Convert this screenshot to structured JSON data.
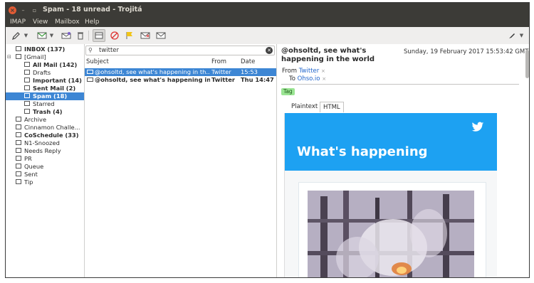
{
  "window": {
    "title": "Spam - 18 unread - Trojitá"
  },
  "menu": [
    "IMAP",
    "View",
    "Mailbox",
    "Help"
  ],
  "folders": [
    {
      "label": "INBOX (137)",
      "bold": true,
      "indent": 0,
      "expander": ""
    },
    {
      "label": "[Gmail]",
      "bold": false,
      "indent": 0,
      "expander": "⊟"
    },
    {
      "label": "All Mail (142)",
      "bold": true,
      "indent": 1,
      "expander": ""
    },
    {
      "label": "Drafts",
      "bold": false,
      "indent": 1,
      "expander": ""
    },
    {
      "label": "Important (14)",
      "bold": true,
      "indent": 1,
      "expander": ""
    },
    {
      "label": "Sent Mail (2)",
      "bold": true,
      "indent": 1,
      "expander": ""
    },
    {
      "label": "Spam (18)",
      "bold": true,
      "indent": 1,
      "expander": "",
      "selected": true
    },
    {
      "label": "Starred",
      "bold": false,
      "indent": 1,
      "expander": ""
    },
    {
      "label": "Trash (4)",
      "bold": true,
      "indent": 1,
      "expander": ""
    },
    {
      "label": "Archive",
      "bold": false,
      "indent": 0,
      "expander": ""
    },
    {
      "label": "Cinnamon Challe...",
      "bold": false,
      "indent": 0,
      "expander": ""
    },
    {
      "label": "CoSchedule (33)",
      "bold": true,
      "indent": 0,
      "expander": ""
    },
    {
      "label": "N1-Snoozed",
      "bold": false,
      "indent": 0,
      "expander": ""
    },
    {
      "label": "Needs Reply",
      "bold": false,
      "indent": 0,
      "expander": ""
    },
    {
      "label": "PR",
      "bold": false,
      "indent": 0,
      "expander": ""
    },
    {
      "label": "Queue",
      "bold": false,
      "indent": 0,
      "expander": ""
    },
    {
      "label": "Sent",
      "bold": false,
      "indent": 0,
      "expander": ""
    },
    {
      "label": "Tip",
      "bold": false,
      "indent": 0,
      "expander": ""
    }
  ],
  "search": {
    "value": "twitter"
  },
  "columns": {
    "subject": "Subject",
    "from": "From",
    "date": "Date"
  },
  "messages": [
    {
      "subject": "@ohsoltd, see what's happening in th...",
      "from": "Twitter",
      "date": "15:53",
      "selected": true,
      "bold": false
    },
    {
      "subject": "@ohsoltd, see what's happening in ...",
      "from": "Twitter",
      "date": "Thu 14:47",
      "selected": false,
      "bold": true
    }
  ],
  "message": {
    "subject": "@ohsoltd, see what's happening in the world",
    "date": "Sunday, 19 February 2017 15:53:42 GMT",
    "from_label": "From",
    "from_value": "Twitter",
    "to_label": "To",
    "to_value": "Ohso.io",
    "tag": "Tag",
    "tabs": [
      "Plaintext",
      "HTML"
    ],
    "active_tab": "HTML",
    "banner_title": "What's happening"
  },
  "colors": {
    "selection": "#3d86d4",
    "twitter_blue": "#1da1f2",
    "tag_green": "#9be594"
  },
  "icons": [
    "pen-icon",
    "message-icon",
    "mark-read-icon",
    "trash-icon",
    "show-message-icon",
    "no-icon",
    "flag-icon",
    "envelope-x-icon",
    "envelope-icon",
    "compose-icon",
    "twitter-bird-icon"
  ]
}
